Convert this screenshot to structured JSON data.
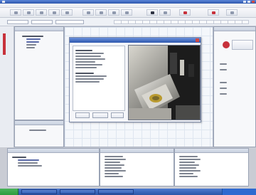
{
  "window": {
    "title": "",
    "accent_blue": "#2e57ad",
    "taskbar_blue": "#3a67bf",
    "start_green": "#2d9b3d",
    "accent_red": "#c7313b"
  },
  "menu_items": [
    "",
    "",
    "",
    "",
    "",
    "",
    "",
    "",
    "",
    "",
    ""
  ],
  "toolbar": {
    "buttons": [
      {
        "icon": "new-icon"
      },
      {
        "icon": "open-icon"
      },
      {
        "icon": "save-icon"
      },
      {
        "icon": "cut-icon"
      },
      {
        "icon": "copy-icon"
      },
      {
        "icon": "paste-icon"
      },
      {
        "icon": "undo-icon"
      },
      {
        "icon": "redo-icon"
      },
      {
        "icon": "settings-icon"
      },
      {
        "icon": "run-icon"
      },
      {
        "icon": "stop-icon"
      },
      {
        "icon": "camera-icon"
      },
      {
        "icon": "alarm-icon"
      },
      {
        "icon": "help-icon"
      }
    ]
  },
  "project_tree": {
    "root": "",
    "items": [
      "",
      "",
      "",
      "",
      ""
    ]
  },
  "dialog": {
    "title": "",
    "left_text_lines": [
      "",
      "",
      "",
      "",
      "",
      "",
      "",
      "",
      "",
      "",
      "",
      "",
      "",
      ""
    ],
    "buttons": [
      "",
      "",
      ""
    ],
    "image": "camera-preview-image"
  },
  "right_panel": {
    "labels": [
      "",
      "",
      "",
      "",
      ""
    ],
    "button_label": ""
  },
  "bottom_left": {
    "header": "",
    "lines": [
      "",
      "",
      "",
      ""
    ]
  },
  "bottom_middle": {
    "header": "",
    "rows": [
      "",
      "",
      "",
      "",
      "",
      "",
      "",
      "",
      "",
      ""
    ]
  },
  "bottom_right": {
    "header": "",
    "rows": [
      "",
      "",
      "",
      "",
      "",
      "",
      "",
      "",
      "",
      ""
    ]
  },
  "status_bar": {
    "text": ""
  },
  "taskbar": {
    "start_label": "",
    "items": [
      "",
      "",
      "",
      ""
    ],
    "clock": ""
  }
}
